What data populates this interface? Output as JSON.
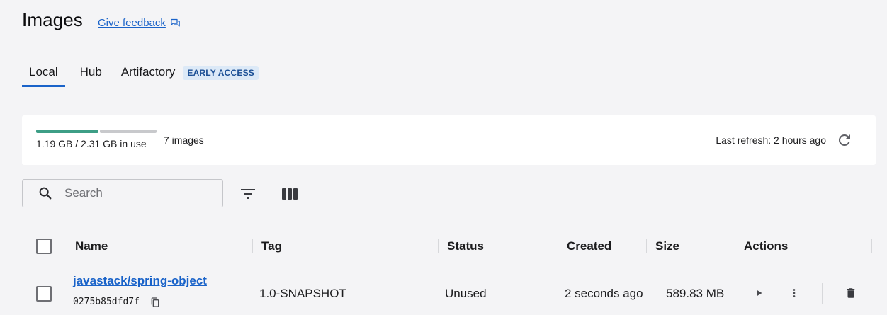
{
  "header": {
    "title": "Images",
    "feedback_label": "Give feedback"
  },
  "tabs": [
    {
      "label": "Local",
      "active": true
    },
    {
      "label": "Hub",
      "active": false
    },
    {
      "label": "Artifactory",
      "active": false,
      "badge": "EARLY ACCESS"
    }
  ],
  "usage": {
    "used_fraction": 0.515,
    "text": "1.19 GB / 2.31 GB in use",
    "count": "7 images",
    "last_refresh": "Last refresh: 2 hours ago",
    "used_color": "#3d9e86",
    "free_color": "#c8c9cc"
  },
  "toolbar": {
    "search_placeholder": "Search",
    "icons": [
      "search-icon",
      "filter-icon",
      "columns-icon"
    ]
  },
  "table": {
    "columns": [
      "Name",
      "Tag",
      "Status",
      "Created",
      "Size",
      "Actions"
    ],
    "rows": [
      {
        "name": "javastack/spring-object",
        "id": "0275b85dfd7f",
        "tag": "1.0-SNAPSHOT",
        "status": "Unused",
        "created": "2 seconds ago",
        "size": "589.83 MB",
        "selected": false
      }
    ]
  },
  "colors": {
    "accent": "#1a63c9",
    "background": "#f4f4f6",
    "card": "#ffffff",
    "badge_bg": "#dce9f7"
  }
}
